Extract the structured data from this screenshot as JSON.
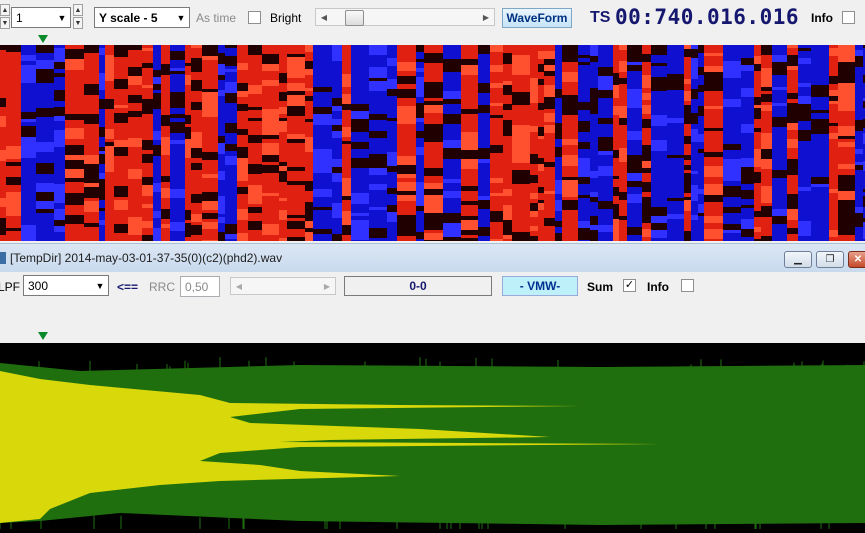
{
  "toolbar": {
    "channel_value": "1",
    "yscale_value": "Y scale - 5",
    "as_time_label": "As time",
    "bright_label": "Bright",
    "bright_checked": false,
    "waveform_button": "WaveForm",
    "ts_label": "TS",
    "ts_value": "00:740.016.016",
    "info_label": "Info",
    "info_checked": false
  },
  "window": {
    "title": "[TempDir] 2014-may-03-01-37-35(0)(c2)(phd2).wav"
  },
  "toolbar2": {
    "lpf_label": "LPF",
    "lpf_value": "300",
    "arrow_label": "<==",
    "rrc_label": "RRC",
    "rrc_value": "0,50",
    "range_value": "0-0",
    "vmw_label": "- VMW-",
    "sum_label": "Sum",
    "sum_checked": true,
    "info_label": "Info",
    "info_checked": false
  },
  "colors": {
    "spectro_red": "#e02010",
    "spectro_blue": "#1010d0",
    "wave_green": "#1f6f0f",
    "wave_yellow": "#d8d80a",
    "ts_blue": "#15186e"
  }
}
